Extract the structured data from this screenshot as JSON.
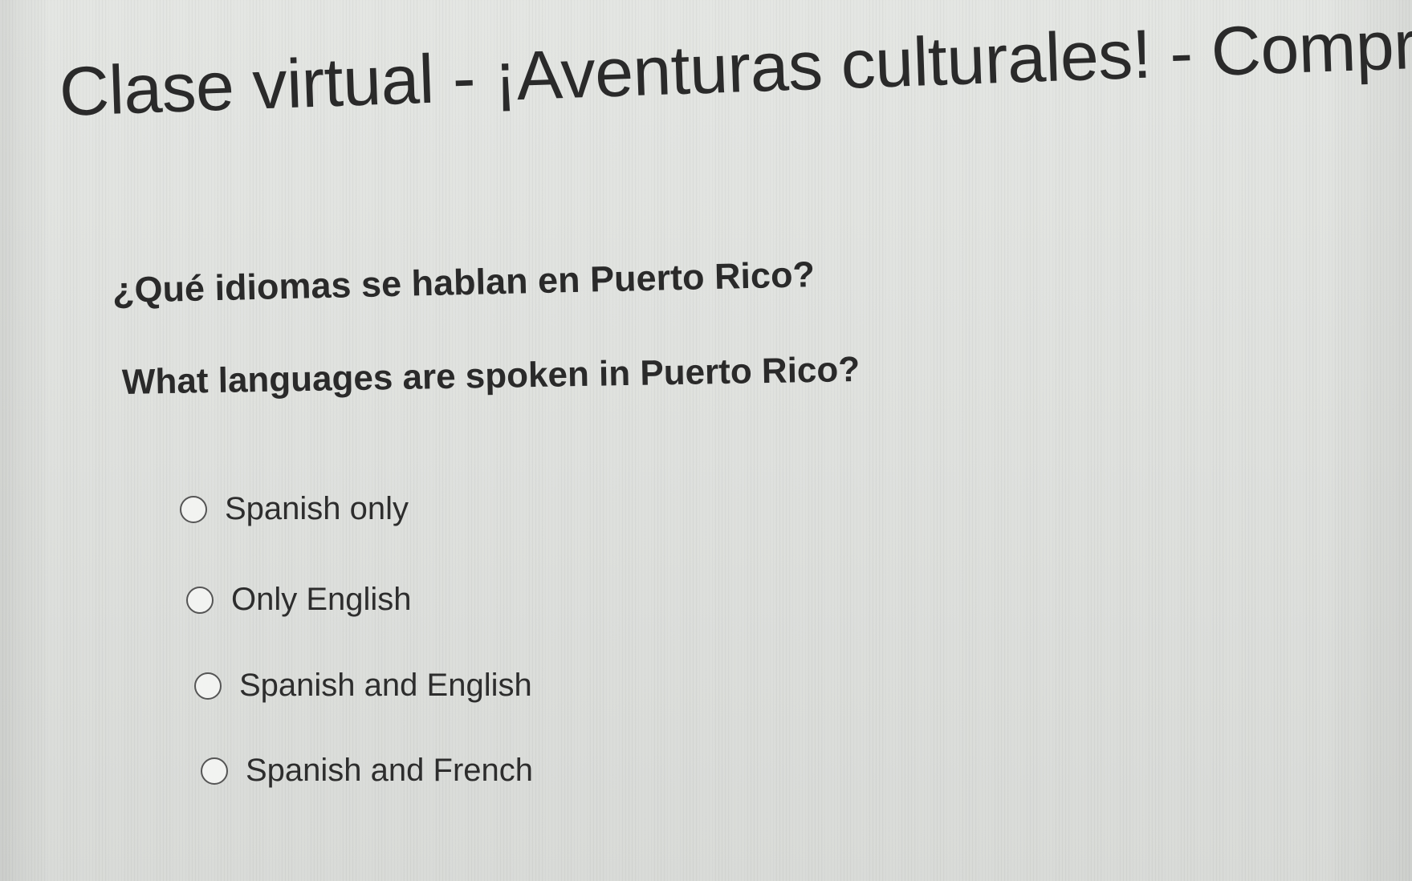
{
  "page": {
    "title": "Clase virtual - ¡Aventuras culturales! - Compre"
  },
  "question": {
    "spanish": "¿Qué idiomas se hablan en Puerto Rico?",
    "english": "What languages are spoken in Puerto Rico?"
  },
  "options": [
    {
      "label": "Spanish only",
      "selected": false
    },
    {
      "label": "Only English",
      "selected": false
    },
    {
      "label": "Spanish and English",
      "selected": false
    },
    {
      "label": "Spanish and French",
      "selected": false
    }
  ]
}
